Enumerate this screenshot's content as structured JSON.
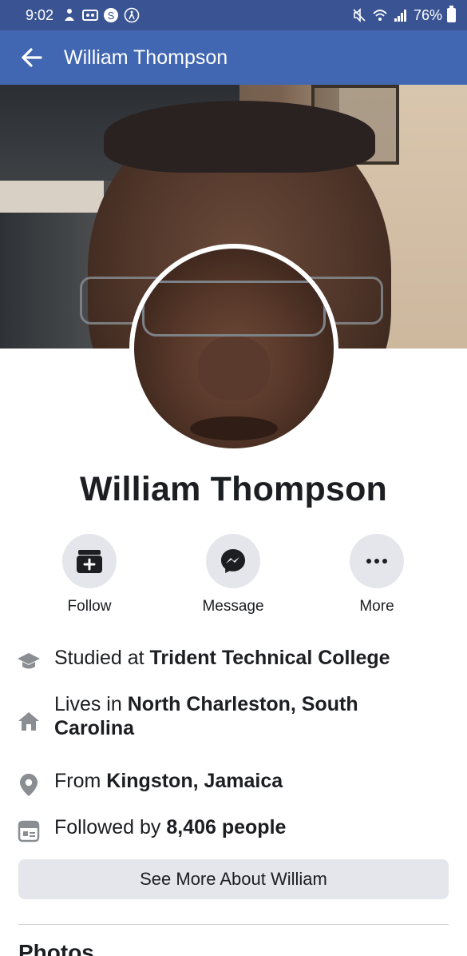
{
  "status_bar": {
    "time": "9:02",
    "battery": "76%",
    "left_icons": [
      "notification-icon",
      "voicemail-icon",
      "s-app-icon",
      "accessibility-icon"
    ],
    "right_icons": [
      "mute-icon",
      "wifi-icon",
      "signal-icon",
      "battery-icon"
    ]
  },
  "app_bar": {
    "title": "William Thompson",
    "color": "#4267b2"
  },
  "profile": {
    "name": "William Thompson"
  },
  "actions": [
    {
      "label": "Follow",
      "icon": "follow-icon"
    },
    {
      "label": "Message",
      "icon": "messenger-icon"
    },
    {
      "label": "More",
      "icon": "more-icon"
    }
  ],
  "info": {
    "studied": {
      "prefix": "Studied at ",
      "value": "Trident Technical College",
      "icon": "graduation-cap-icon"
    },
    "lives": {
      "prefix": "Lives in ",
      "value": "North Charleston, South Carolina",
      "icon": "home-icon"
    },
    "from": {
      "prefix": "From ",
      "value": "Kingston, Jamaica",
      "icon": "location-pin-icon"
    },
    "followers": {
      "prefix": "Followed by ",
      "value": "8,406 people",
      "icon": "followers-icon"
    }
  },
  "see_more_label": "See More About William",
  "next_section_title": "Photos"
}
